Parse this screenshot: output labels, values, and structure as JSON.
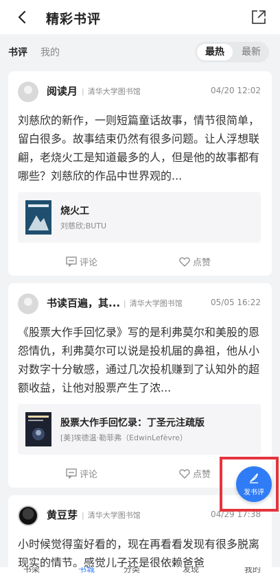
{
  "header": {
    "title": "精彩书评"
  },
  "tabs": {
    "review": "书评",
    "mine": "我的"
  },
  "sort": {
    "hot": "最热",
    "new": "最新"
  },
  "reviews": [
    {
      "user": "阅读月",
      "library": "清华大学图书馆",
      "time": "04/20 12:02",
      "content": "刘慈欣的新作，一则短篇童话故事，情节很简单，留白很多。故事结束仍然有很多问题。让人浮想联翩，老烧火工是知道最多的人，但是他的故事都有哪些？刘慈欣的作品中世界观的...",
      "book_title": "烧火工",
      "book_author": "刘慈欣;BUTU",
      "comment": "评论",
      "like": "点赞"
    },
    {
      "user": "书读百遍，其...",
      "library": "清华大学图书馆",
      "time": "05/05 16:22",
      "content": "《股票大作手回忆录》写的是利弗莫尔和美股的恩怨情仇，利弗莫尔可以说是投机届的鼻祖，他从小对数字十分敏感，通过几次投机赚到了认知外的超额收益，让他对股票产生了浓...",
      "book_title": "股票大作手回忆录：丁圣元注疏版",
      "book_author": "[美]埃德温·勒菲弗（EdwinLefèvre）",
      "comment": "评论",
      "like": "点赞"
    },
    {
      "user": "黄豆芽",
      "library": "清华大学图书馆",
      "time": "04/29 17:38",
      "content": "小时候觉得蛮好看的，现在再看看发现有很多脱离现实的情节。感觉儿子还是很依赖爸爸"
    }
  ],
  "fab": {
    "label": "发书评"
  },
  "bottom_nav": [
    "书架",
    "书城",
    "分类",
    "发现",
    "我的"
  ],
  "colors": {
    "accent": "#2f7cf6",
    "highlight_box": "#e5343c"
  }
}
